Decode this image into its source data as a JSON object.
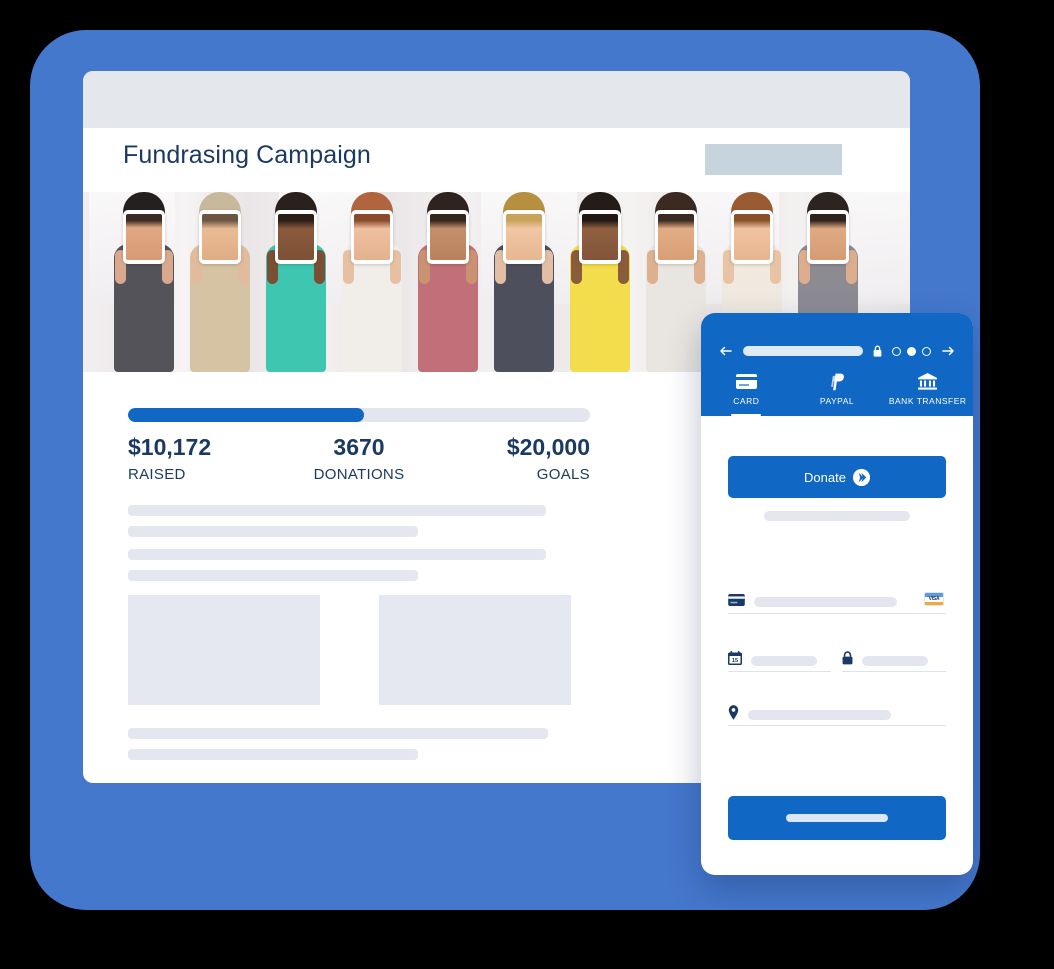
{
  "theme": {
    "frame_blue": "#4478cd",
    "brand_blue": "#1068c4",
    "navy_text": "#1b3a63",
    "skeleton_gray": "#e5e7f0",
    "chrome_gray": "#e4e7ec",
    "badge_gray": "#c8d4dd"
  },
  "browser": {
    "page_title": "Fundrasing Campaign",
    "header_badge_label": "",
    "hero_image_alt": "Group of people holding tablets showing their faces"
  },
  "campaign": {
    "progress_percent": 51,
    "stats": [
      {
        "value": "$10,172",
        "label": "RAISED",
        "align": "left"
      },
      {
        "value": "3670",
        "label": "DONATIONS",
        "align": "center"
      },
      {
        "value": "$20,000",
        "label": "GOALS",
        "align": "right"
      }
    ]
  },
  "phone": {
    "nav": {
      "back_icon": "arrow-left-icon",
      "forward_icon": "arrow-right-icon",
      "lock_icon": "lock-icon",
      "url_value": "",
      "url_placeholder": "",
      "page_dots": [
        {
          "state": "empty"
        },
        {
          "state": "filled"
        },
        {
          "state": "empty"
        }
      ]
    },
    "tabs": [
      {
        "label": "CARD",
        "icon": "credit-card-icon",
        "active": true
      },
      {
        "label": "PAYPAL",
        "icon": "paypal-icon",
        "active": false
      },
      {
        "label": "BANK TRANSFER",
        "icon": "bank-icon",
        "active": false
      }
    ],
    "donate_button": {
      "label": "Donate",
      "icon": "chevron-circle-right-icon"
    },
    "form": {
      "card_number": {
        "icon": "credit-card-icon",
        "value": "",
        "brand": "VISA"
      },
      "expiry": {
        "icon": "calendar-icon",
        "icon_day": "15",
        "value": ""
      },
      "cvv": {
        "icon": "lock-icon",
        "value": ""
      },
      "address": {
        "icon": "location-pin-icon",
        "value": ""
      }
    },
    "submit_button": {
      "label": ""
    }
  }
}
